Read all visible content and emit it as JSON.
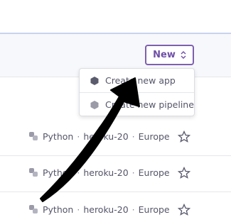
{
  "header": {
    "new_button_label": "New",
    "new_button_icon": "chevron-updown-icon"
  },
  "dropdown": {
    "items": [
      {
        "label": "Create new app",
        "icon": "app-hexagon-icon"
      },
      {
        "label": "Create new pipeline",
        "icon": "pipeline-icon"
      }
    ]
  },
  "apps": [
    {
      "language": "Python",
      "stack": "heroku-20",
      "region": "Europe"
    },
    {
      "language": "Python",
      "stack": "heroku-20",
      "region": "Europe"
    },
    {
      "language": "Python",
      "stack": "heroku-20",
      "region": "Europe"
    }
  ],
  "separator": "·",
  "colors": {
    "accent": "#7e5fb0",
    "text": "#55556a",
    "arrow": "#000000"
  }
}
